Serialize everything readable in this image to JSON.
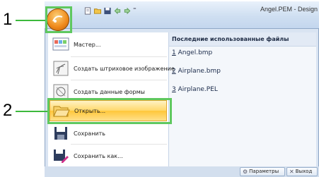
{
  "window": {
    "title": "Angel.PEM - Design"
  },
  "quick_access": {
    "icons": [
      "new-icon",
      "open-folder-icon",
      "save-icon",
      "undo-icon",
      "redo-icon",
      "customize-dropdown-icon"
    ],
    "customize_glyph": "⁼"
  },
  "callouts": {
    "one": "1",
    "two": "2"
  },
  "menu": {
    "commands": [
      {
        "label": "Мастер...",
        "icon": "wizard-icon"
      },
      {
        "label": "Создать штриховое изображение",
        "icon": "line-image-icon"
      },
      {
        "label": "Создать данные формы",
        "icon": "shape-data-icon"
      },
      {
        "label": "Открыть...",
        "icon": "open-folder-icon"
      },
      {
        "label": "Сохранить",
        "icon": "save-icon"
      },
      {
        "label": "Сохранить как...",
        "icon": "save-as-icon"
      }
    ],
    "recent_title": "Последние использованные файлы",
    "recent_files": [
      {
        "num": "1",
        "name": "Angel.bmp"
      },
      {
        "num": "2",
        "name": "Airplane.bmp"
      },
      {
        "num": "3",
        "name": "Airplane.PEL"
      }
    ],
    "options_label": "Параметры",
    "exit_label": "Выход"
  },
  "colors": {
    "accent_green": "#3cb93c",
    "highlight": "#ffd86a",
    "orb": "#f08a1c"
  }
}
